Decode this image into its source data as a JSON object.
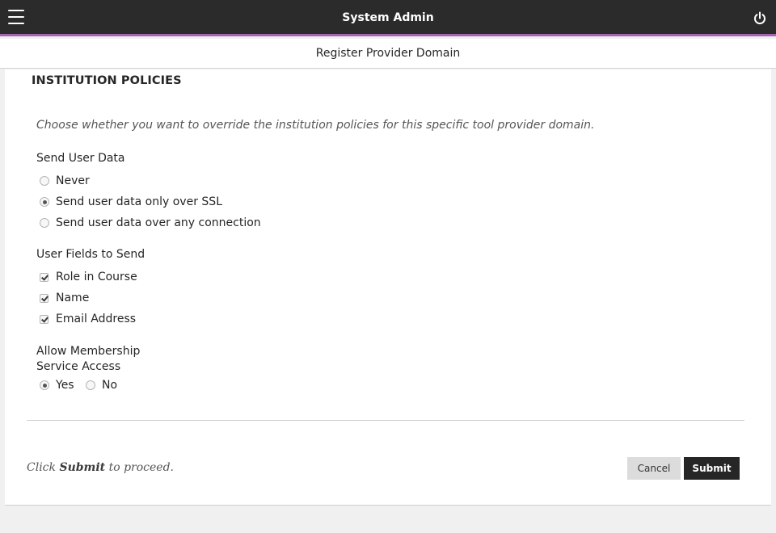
{
  "header": {
    "title": "System Admin",
    "menu_icon": "hamburger-menu-icon",
    "power_icon": "power-icon"
  },
  "subheader": {
    "title": "Register Provider Domain"
  },
  "section": {
    "title": "INSTITUTION POLICIES",
    "instructions": "Choose whether you want to override the institution policies for this specific tool provider domain."
  },
  "send_user_data": {
    "label": "Send User Data",
    "options": [
      {
        "label": "Never",
        "checked": false
      },
      {
        "label": "Send user data only over SSL",
        "checked": true
      },
      {
        "label": "Send user data over any connection",
        "checked": false
      }
    ]
  },
  "user_fields": {
    "label": "User Fields to Send",
    "options": [
      {
        "label": "Role in Course",
        "checked": true
      },
      {
        "label": "Name",
        "checked": true
      },
      {
        "label": "Email Address",
        "checked": true
      }
    ]
  },
  "membership": {
    "label_line1": "Allow Membership",
    "label_line2": "Service Access",
    "options": [
      {
        "label": "Yes",
        "checked": true
      },
      {
        "label": "No",
        "checked": false
      }
    ]
  },
  "footer": {
    "click_prefix": "Click",
    "click_strong": "Submit",
    "click_suffix": "to proceed.",
    "cancel_label": "Cancel",
    "submit_label": "Submit"
  },
  "colors": {
    "topbar": "#2b2b2b",
    "accent": "#a565b3",
    "submit_button": "#262626",
    "cancel_button": "#dcdcdc"
  }
}
